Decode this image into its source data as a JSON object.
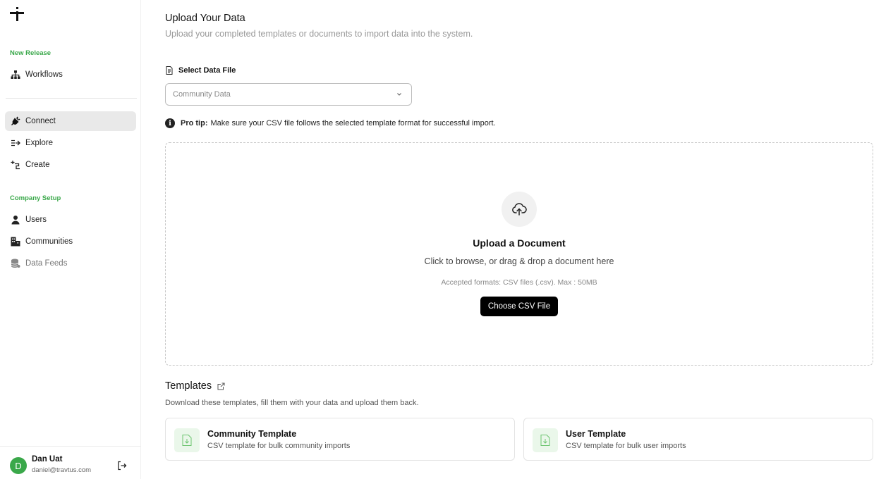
{
  "sidebar": {
    "sections": [
      {
        "label": "New Release",
        "items": [
          {
            "label": "Workflows",
            "icon": "hierarchy-icon"
          }
        ]
      },
      {
        "label": "",
        "items": [
          {
            "label": "Connect",
            "icon": "plug-icon",
            "active": true
          },
          {
            "label": "Explore",
            "icon": "arrow-in-icon"
          },
          {
            "label": "Create",
            "icon": "create-icon"
          }
        ]
      },
      {
        "label": "Company Setup",
        "items": [
          {
            "label": "Users",
            "icon": "user-icon"
          },
          {
            "label": "Communities",
            "icon": "building-icon"
          },
          {
            "label": "Data Feeds",
            "icon": "database-icon",
            "muted": true
          }
        ]
      }
    ],
    "user": {
      "initial": "D",
      "name": "Dan Uat",
      "email": "daniel@travtus.com"
    }
  },
  "main": {
    "title": "Upload Your Data",
    "subtitle": "Upload your completed templates or documents to import data into the system.",
    "select": {
      "label": "Select Data File",
      "value": "Community Data"
    },
    "tip": {
      "bold": "Pro tip:",
      "text": "Make sure your CSV file follows the selected template format for successful import."
    },
    "dropzone": {
      "title": "Upload a Document",
      "subtitle": "Click to browse, or drag & drop a document here",
      "formats": "Accepted formats: CSV files (.csv). Max : 50MB",
      "button": "Choose CSV File"
    },
    "templates": {
      "title": "Templates",
      "subtitle": "Download these templates, fill them with your data and upload them back.",
      "cards": [
        {
          "name": "Community Template",
          "desc": "CSV template for bulk community imports"
        },
        {
          "name": "User Template",
          "desc": "CSV template for bulk user imports"
        }
      ]
    }
  },
  "colors": {
    "accent": "#3aa84a",
    "active_bg": "#e9e9e9",
    "button_bg": "#000000"
  }
}
